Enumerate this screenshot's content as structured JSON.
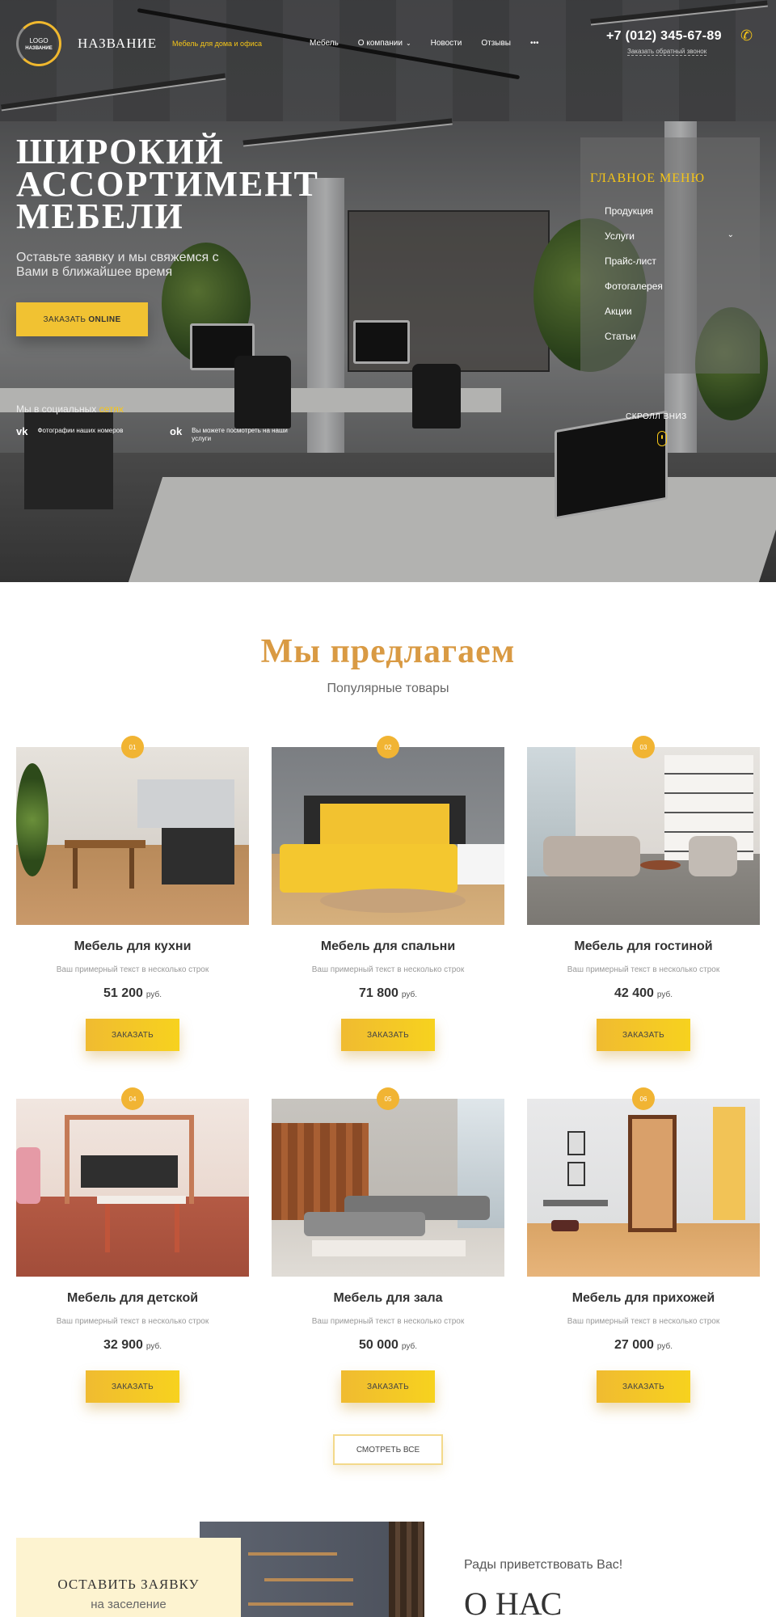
{
  "header": {
    "logo_line1": "LOGO",
    "logo_line2": "НАЗВАНИЕ",
    "brand_name": "НАЗВАНИЕ",
    "brand_tagline": "Мебель для дома и офиса",
    "nav": [
      {
        "label": "Мебель",
        "has_dropdown": false
      },
      {
        "label": "О компании",
        "has_dropdown": true
      },
      {
        "label": "Новости",
        "has_dropdown": false
      },
      {
        "label": "Отзывы",
        "has_dropdown": false
      },
      {
        "label": "•••",
        "has_dropdown": false
      }
    ],
    "phone": "+7 (012) 345-67-89",
    "callback": "Заказать обратный звонок",
    "phone_icon": "phone-icon"
  },
  "hero": {
    "headline": "Широкий ассортимент мебели",
    "subline": "Оставьте заявку и мы свяжемся с Вами в ближайшее время",
    "order_label": "ЗАКАЗАТЬ",
    "order_label_bold": "ONLINE",
    "social_title": "Мы в социальных",
    "social_title_hl": "сетях",
    "social": [
      {
        "icon": "vk-icon",
        "glyph": "vk",
        "text": "Фотографии наших номеров"
      },
      {
        "icon": "ok-icon",
        "glyph": "ok",
        "text": "Вы можете посмотреть на наши услуги"
      }
    ],
    "main_menu_title": "Главное меню",
    "main_menu": [
      {
        "label": "Продукция",
        "has_dropdown": false
      },
      {
        "label": "Услуги",
        "has_dropdown": true
      },
      {
        "label": "Прайс-лист",
        "has_dropdown": false
      },
      {
        "label": "Фотогалерея",
        "has_dropdown": false
      },
      {
        "label": "Акции",
        "has_dropdown": false
      },
      {
        "label": "Статьи",
        "has_dropdown": false
      }
    ],
    "scroll_down": "СКРОЛЛ ВНИЗ"
  },
  "offers": {
    "title": "Мы предлагаем",
    "subtitle": "Популярные товары",
    "buy_label": "ЗАКАЗАТЬ",
    "currency": "руб.",
    "items": [
      {
        "num": "01",
        "name": "Мебель для кухни",
        "desc": "Ваш примерный текст в несколько строк",
        "price": "51 200"
      },
      {
        "num": "02",
        "name": "Мебель для спальни",
        "desc": "Ваш примерный текст в несколько строк",
        "price": "71 800"
      },
      {
        "num": "03",
        "name": "Мебель для гостиной",
        "desc": "Ваш примерный текст в несколько строк",
        "price": "42 400"
      },
      {
        "num": "04",
        "name": "Мебель для детской",
        "desc": "Ваш примерный текст в несколько строк",
        "price": "32 900"
      },
      {
        "num": "05",
        "name": "Мебель для зала",
        "desc": "Ваш примерный текст в несколько строк",
        "price": "50 000"
      },
      {
        "num": "06",
        "name": "Мебель для прихожей",
        "desc": "Ваш примерный текст в несколько строк",
        "price": "27 000"
      }
    ],
    "see_all": "СМОТРЕТЬ ВСЕ"
  },
  "request": {
    "title": "Оставить заявку",
    "subtitle": "на заселение"
  },
  "about": {
    "welcome": "Рады приветствовать Вас!",
    "title": "О нас"
  },
  "colors": {
    "accent": "#f1c232",
    "title_gold": "#d99a43",
    "brand_yellow": "#f5c518"
  }
}
